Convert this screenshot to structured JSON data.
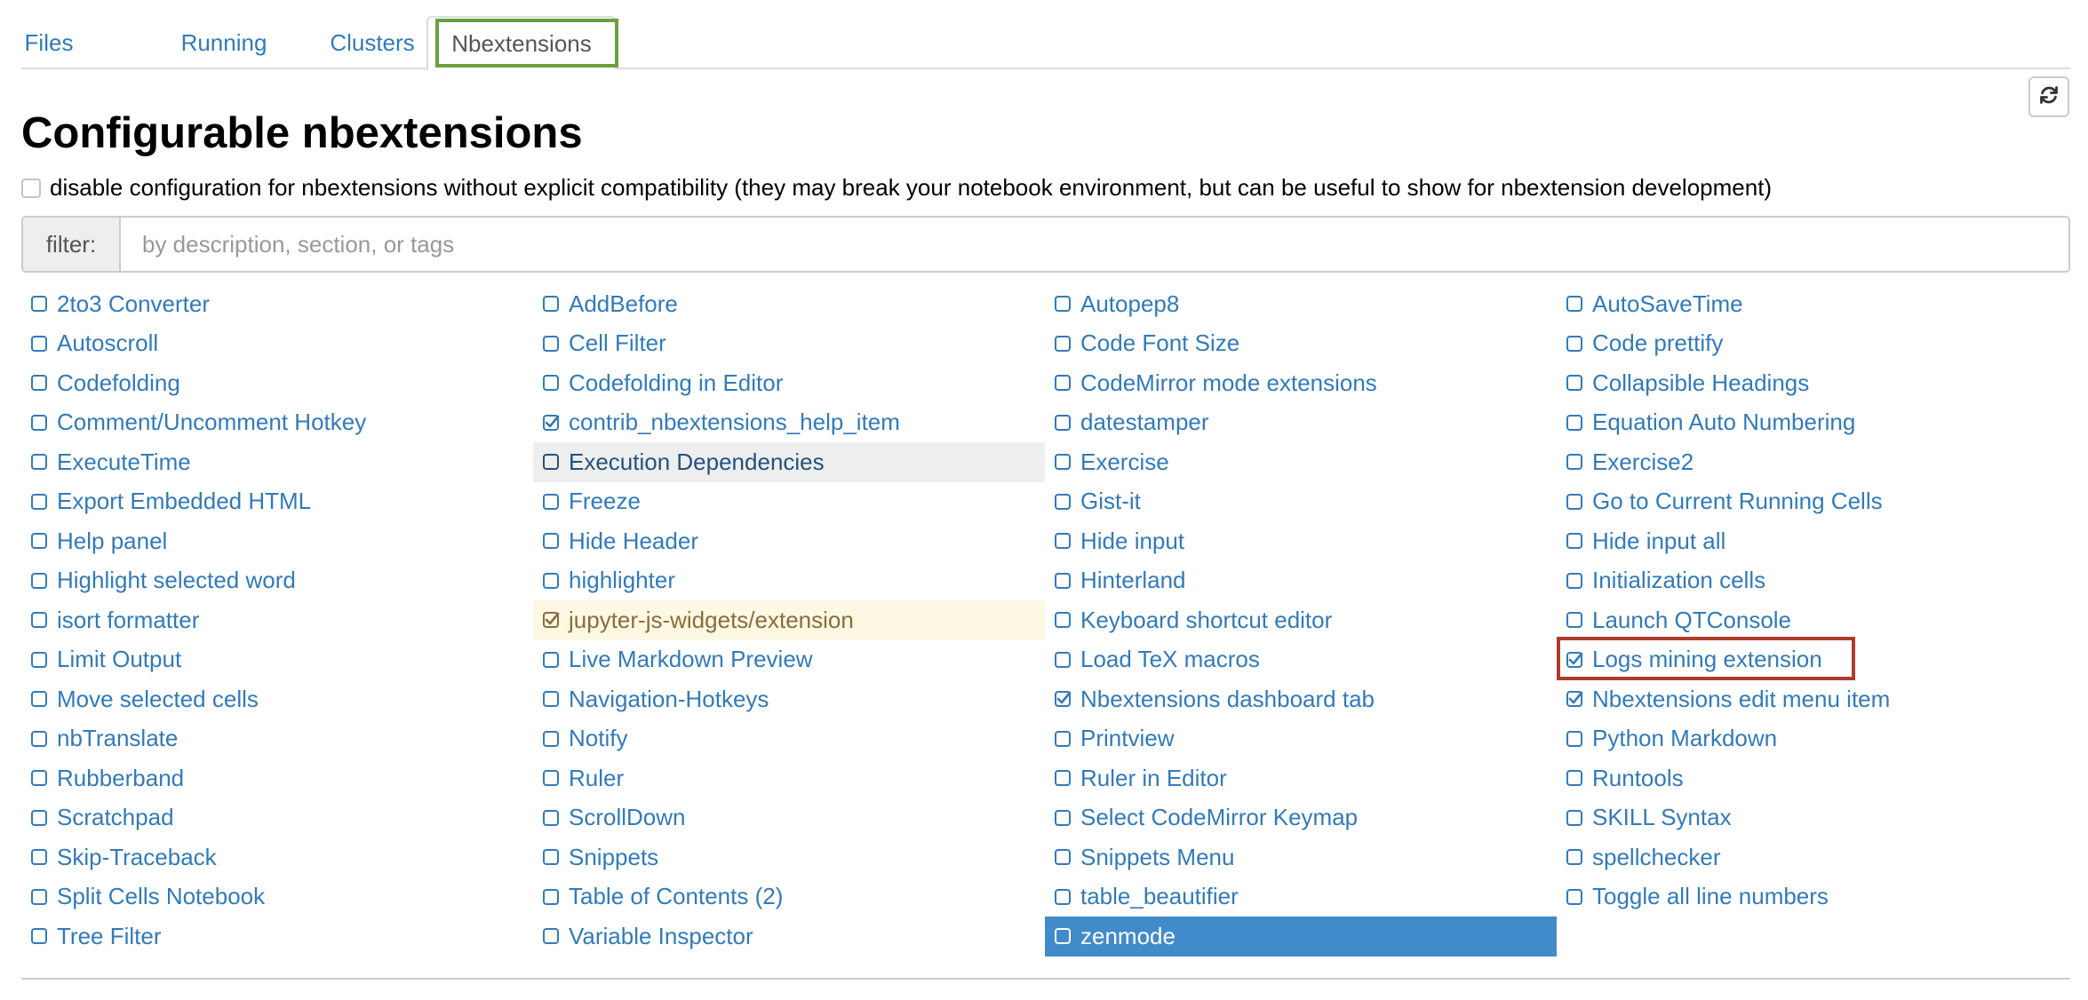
{
  "tabs": [
    {
      "label": "Files",
      "active": false
    },
    {
      "label": "Running",
      "active": false
    },
    {
      "label": "Clusters",
      "active": false
    },
    {
      "label": "Nbextensions",
      "active": true
    }
  ],
  "refresh_icon": "refresh-icon",
  "title": "Configurable nbextensions",
  "compat": {
    "label": "disable configuration for nbextensions without explicit compatibility (they may break your notebook environment, but can be useful to show for nbextension development)",
    "checked": false
  },
  "filter": {
    "label": "filter:",
    "placeholder": "by description, section, or tags"
  },
  "colors": {
    "link": "#337ab7",
    "selected_bg": "#428bca",
    "warning_bg": "#fcf8e3",
    "hover_bg": "#eeeeee",
    "tab_highlight": "#6a9f3e",
    "item_highlight": "#b03a2e"
  },
  "columns": [
    [
      {
        "label": "2to3 Converter",
        "checked": false
      },
      {
        "label": "Autoscroll",
        "checked": false
      },
      {
        "label": "Codefolding",
        "checked": false
      },
      {
        "label": "Comment/Uncomment Hotkey",
        "checked": false
      },
      {
        "label": "ExecuteTime",
        "checked": false
      },
      {
        "label": "Export Embedded HTML",
        "checked": false
      },
      {
        "label": "Help panel",
        "checked": false
      },
      {
        "label": "Highlight selected word",
        "checked": false
      },
      {
        "label": "isort formatter",
        "checked": false
      },
      {
        "label": "Limit Output",
        "checked": false
      },
      {
        "label": "Move selected cells",
        "checked": false
      },
      {
        "label": "nbTranslate",
        "checked": false
      },
      {
        "label": "Rubberband",
        "checked": false
      },
      {
        "label": "Scratchpad",
        "checked": false
      },
      {
        "label": "Skip-Traceback",
        "checked": false
      },
      {
        "label": "Split Cells Notebook",
        "checked": false
      },
      {
        "label": "Tree Filter",
        "checked": false
      }
    ],
    [
      {
        "label": "AddBefore",
        "checked": false
      },
      {
        "label": "Cell Filter",
        "checked": false
      },
      {
        "label": "Codefolding in Editor",
        "checked": false
      },
      {
        "label": "contrib_nbextensions_help_item",
        "checked": true
      },
      {
        "label": "Execution Dependencies",
        "checked": false,
        "state": "hover"
      },
      {
        "label": "Freeze",
        "checked": false
      },
      {
        "label": "Hide Header",
        "checked": false
      },
      {
        "label": "highlighter",
        "checked": false
      },
      {
        "label": "jupyter-js-widgets/extension",
        "checked": true,
        "state": "warning"
      },
      {
        "label": "Live Markdown Preview",
        "checked": false
      },
      {
        "label": "Navigation-Hotkeys",
        "checked": false
      },
      {
        "label": "Notify",
        "checked": false
      },
      {
        "label": "Ruler",
        "checked": false
      },
      {
        "label": "ScrollDown",
        "checked": false
      },
      {
        "label": "Snippets",
        "checked": false
      },
      {
        "label": "Table of Contents (2)",
        "checked": false
      },
      {
        "label": "Variable Inspector",
        "checked": false
      }
    ],
    [
      {
        "label": "Autopep8",
        "checked": false
      },
      {
        "label": "Code Font Size",
        "checked": false
      },
      {
        "label": "CodeMirror mode extensions",
        "checked": false
      },
      {
        "label": "datestamper",
        "checked": false
      },
      {
        "label": "Exercise",
        "checked": false
      },
      {
        "label": "Gist-it",
        "checked": false
      },
      {
        "label": "Hide input",
        "checked": false
      },
      {
        "label": "Hinterland",
        "checked": false
      },
      {
        "label": "Keyboard shortcut editor",
        "checked": false
      },
      {
        "label": "Load TeX macros",
        "checked": false
      },
      {
        "label": "Nbextensions dashboard tab",
        "checked": true
      },
      {
        "label": "Printview",
        "checked": false
      },
      {
        "label": "Ruler in Editor",
        "checked": false
      },
      {
        "label": "Select CodeMirror Keymap",
        "checked": false
      },
      {
        "label": "Snippets Menu",
        "checked": false
      },
      {
        "label": "table_beautifier",
        "checked": false
      },
      {
        "label": "zenmode",
        "checked": false,
        "state": "selected"
      }
    ],
    [
      {
        "label": "AutoSaveTime",
        "checked": false
      },
      {
        "label": "Code prettify",
        "checked": false
      },
      {
        "label": "Collapsible Headings",
        "checked": false
      },
      {
        "label": "Equation Auto Numbering",
        "checked": false
      },
      {
        "label": "Exercise2",
        "checked": false
      },
      {
        "label": "Go to Current Running Cells",
        "checked": false
      },
      {
        "label": "Hide input all",
        "checked": false
      },
      {
        "label": "Initialization cells",
        "checked": false
      },
      {
        "label": "Launch QTConsole",
        "checked": false
      },
      {
        "label": "Logs mining extension",
        "checked": true,
        "state": "highlighted"
      },
      {
        "label": "Nbextensions edit menu item",
        "checked": true
      },
      {
        "label": "Python Markdown",
        "checked": false
      },
      {
        "label": "Runtools",
        "checked": false
      },
      {
        "label": "SKILL Syntax",
        "checked": false
      },
      {
        "label": "spellchecker",
        "checked": false
      },
      {
        "label": "Toggle all line numbers",
        "checked": false
      }
    ]
  ]
}
